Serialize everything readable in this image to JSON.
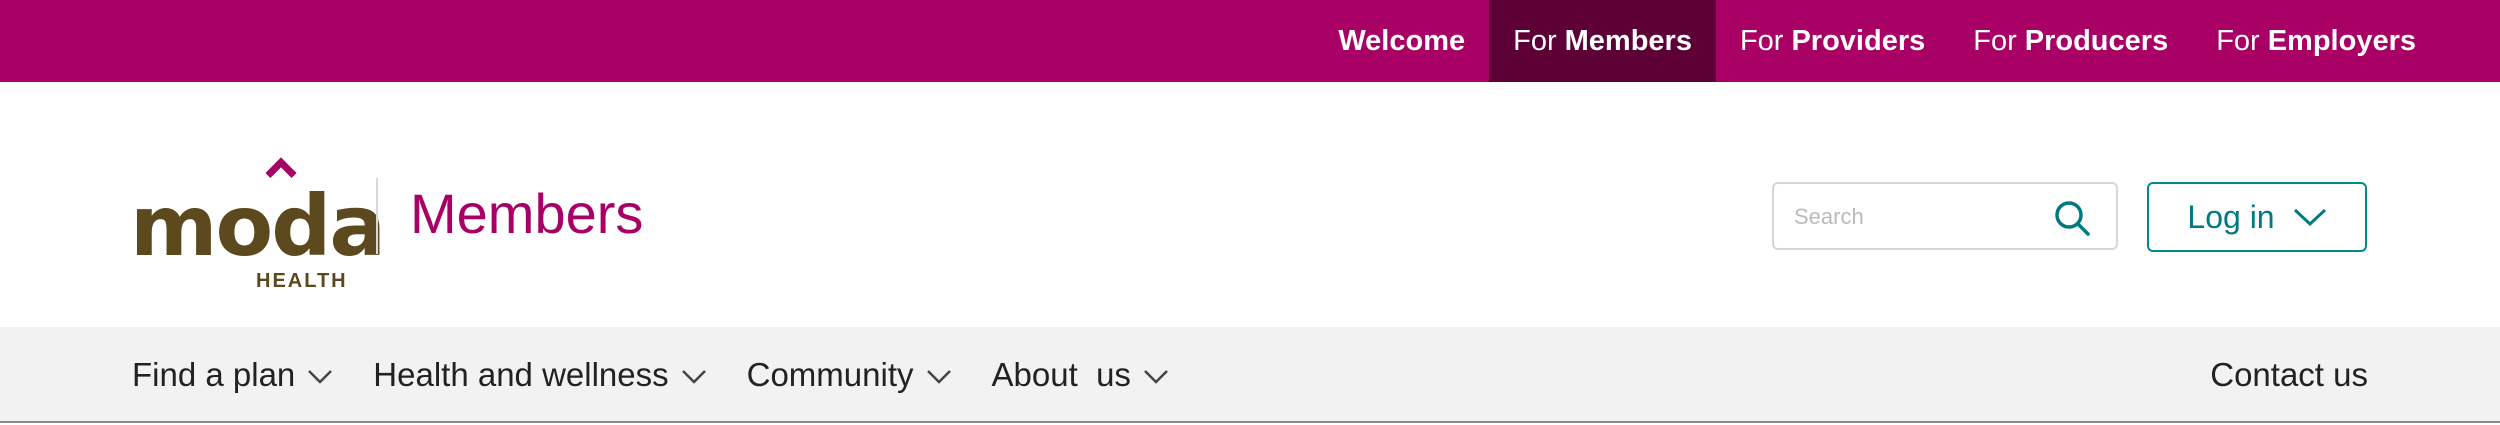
{
  "topnav": {
    "items": [
      {
        "prefix": "",
        "label": "Welcome",
        "active": false
      },
      {
        "prefix": "For",
        "label": "Members",
        "active": true
      },
      {
        "prefix": "For",
        "label": "Providers",
        "active": false
      },
      {
        "prefix": "For",
        "label": "Producers",
        "active": false
      },
      {
        "prefix": "For",
        "label": "Employers",
        "active": false
      }
    ]
  },
  "brand": {
    "logo_word": "moda",
    "logo_sub": "HEALTH",
    "section_title": "Members",
    "colors": {
      "magenta": "#a80064",
      "dark_magenta": "#5c0035",
      "brown": "#5c4a1e",
      "teal": "#007a80"
    }
  },
  "search": {
    "placeholder": "Search",
    "value": "",
    "icon": "search-icon"
  },
  "login": {
    "label": "Log in",
    "icon": "chevron-down-icon"
  },
  "mainnav": {
    "items": [
      {
        "label": "Find a plan"
      },
      {
        "label": "Health and wellness"
      },
      {
        "label": "Community"
      },
      {
        "label": "About  us"
      }
    ],
    "contact_label": "Contact us"
  }
}
